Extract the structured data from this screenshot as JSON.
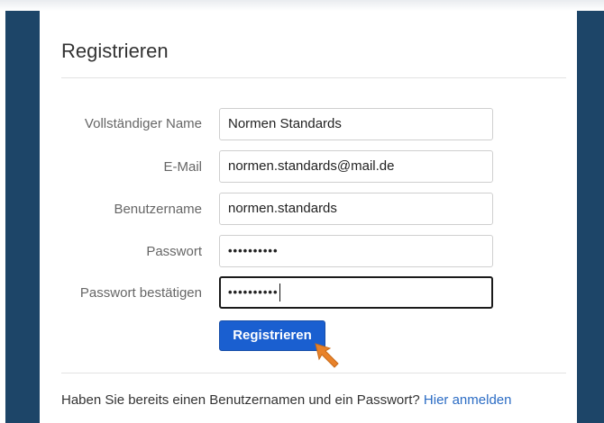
{
  "form": {
    "title": "Registrieren",
    "fields": [
      {
        "label": "Vollständiger Name",
        "value": "Normen Standards"
      },
      {
        "label": "E-Mail",
        "value": "normen.standards@mail.de"
      },
      {
        "label": "Benutzername",
        "value": "normen.standards"
      },
      {
        "label": "Passwort",
        "value": "••••••••••"
      },
      {
        "label": "Passwort bestätigen",
        "value": "••••••••••"
      }
    ],
    "submit_label": "Registrieren"
  },
  "footer": {
    "text": "Haben Sie bereits einen Benutzernamen und ein Passwort?",
    "link_label": "Hier anmelden"
  },
  "colors": {
    "sidebar": "#1d4568",
    "button": "#1a5fd0",
    "link": "#2b6cc4",
    "cursor": "#e8822a"
  },
  "icons": [
    "cursor-arrow-icon"
  ]
}
